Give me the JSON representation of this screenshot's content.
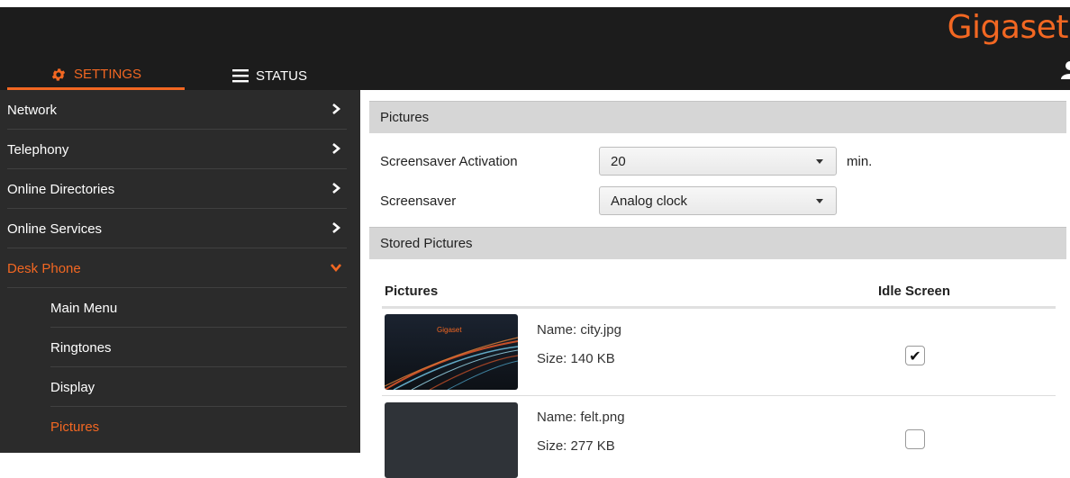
{
  "brand": {
    "logo": "Gigaset",
    "accent": "#f26722"
  },
  "tabs": [
    {
      "label": "SETTINGS",
      "icon": "gear-icon",
      "active": true
    },
    {
      "label": "STATUS",
      "icon": "menu-icon",
      "active": false
    }
  ],
  "sidebar": {
    "items": [
      {
        "label": "Network",
        "icon": "chevron-right-icon"
      },
      {
        "label": "Telephony",
        "icon": "chevron-right-icon"
      },
      {
        "label": "Online Directories",
        "icon": "chevron-right-icon"
      },
      {
        "label": "Online Services",
        "icon": "chevron-right-icon"
      },
      {
        "label": "Desk Phone",
        "icon": "chevron-down-icon",
        "expanded": true
      }
    ],
    "subitems": [
      {
        "label": "Main Menu"
      },
      {
        "label": "Ringtones"
      },
      {
        "label": "Display"
      },
      {
        "label": "Pictures",
        "active": true
      }
    ]
  },
  "main": {
    "section_pictures": "Pictures",
    "screensaver_activation": {
      "label": "Screensaver Activation",
      "value": "20",
      "unit": "min."
    },
    "screensaver": {
      "label": "Screensaver",
      "value": "Analog clock"
    },
    "section_stored": "Stored Pictures",
    "table": {
      "col_pictures": "Pictures",
      "col_idle": "Idle Screen",
      "rows": [
        {
          "name": "Name: city.jpg",
          "size": "Size: 140 KB",
          "thumb_text": "Gigaset",
          "idle_checked": true
        },
        {
          "name": "Name: felt.png",
          "size": "Size: 277 KB",
          "idle_checked": false
        }
      ]
    }
  }
}
